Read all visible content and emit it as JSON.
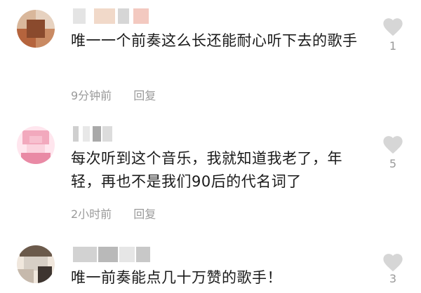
{
  "comments": [
    {
      "text": "唯一一个前奏这么长还能耐心听下去的歌手",
      "time": "9分钟前",
      "reply_label": "回复",
      "likes": "1",
      "avatar_colors": [
        "#d9b79b",
        "#b5643d",
        "#8a4a2d",
        "#e7d2c0",
        "#c98a63"
      ],
      "name_colors": [
        "#e4e4e4",
        "#f1d9c9",
        "#d6d6d6",
        "#f3c9c0"
      ]
    },
    {
      "text": "每次听到这个音乐，我就知道我老了，年轻，再也不是我们90后的代名词了",
      "time": "2小时前",
      "reply_label": "回复",
      "likes": "5",
      "avatar_colors": [
        "#f2a9bd",
        "#fbd3de",
        "#e98aa5",
        "#f7c0cf",
        "#ffe6ee"
      ],
      "name_colors": [
        "#cfcfcf",
        "#e8e8e8",
        "#a9a9a9",
        "#dcdcdc"
      ]
    },
    {
      "text": "唯一前奏能点几十万赞的歌手！",
      "time": "",
      "reply_label": "",
      "likes": "3",
      "avatar_colors": [
        "#d7cfc6",
        "#6b5a4b",
        "#f0e7dd",
        "#3e3530",
        "#c6b9ac"
      ],
      "name_colors": [
        "#d2d2d2",
        "#b9b9b9",
        "#e6e6e6",
        "#c8c8c8"
      ]
    }
  ],
  "colors": {
    "text": "#1a1a1a",
    "meta": "#9a9a9a",
    "heart": "#d6d6d6"
  },
  "icons": {
    "like": "heart-icon"
  }
}
